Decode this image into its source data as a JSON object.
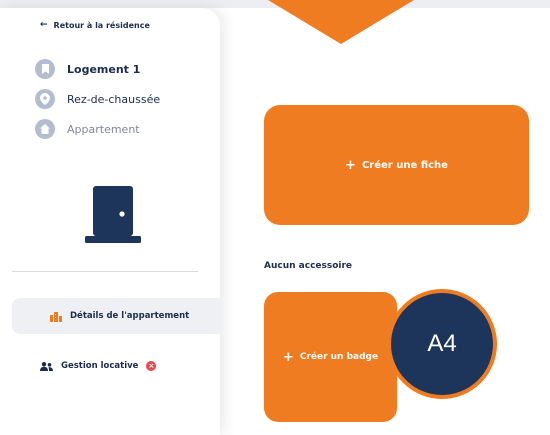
{
  "sidebar": {
    "back_link": "Retour à la résidence",
    "info": [
      {
        "icon": "bookmark-icon",
        "text": "Logement 1"
      },
      {
        "icon": "location-pin-icon",
        "text": "Rez-de-chaussée"
      },
      {
        "icon": "home-icon",
        "text": "Appartement"
      }
    ],
    "illustration": "door-icon",
    "nav": [
      {
        "icon": "building-icon",
        "label": "Détails de l'appartement",
        "active": true
      },
      {
        "icon": "people-icon",
        "label": "Gestion locative",
        "alert": true
      }
    ]
  },
  "main": {
    "create_sheet_label": "Créer une fiche",
    "accessories_label": "Aucun accessoire",
    "create_badge_label": "Créer un badge"
  },
  "overlay": {
    "marker_label": "A4"
  },
  "colors": {
    "accent": "#ef7c21",
    "navy": "#1d2c4d",
    "marker": "#1d355b",
    "alert": "#e5484d"
  }
}
